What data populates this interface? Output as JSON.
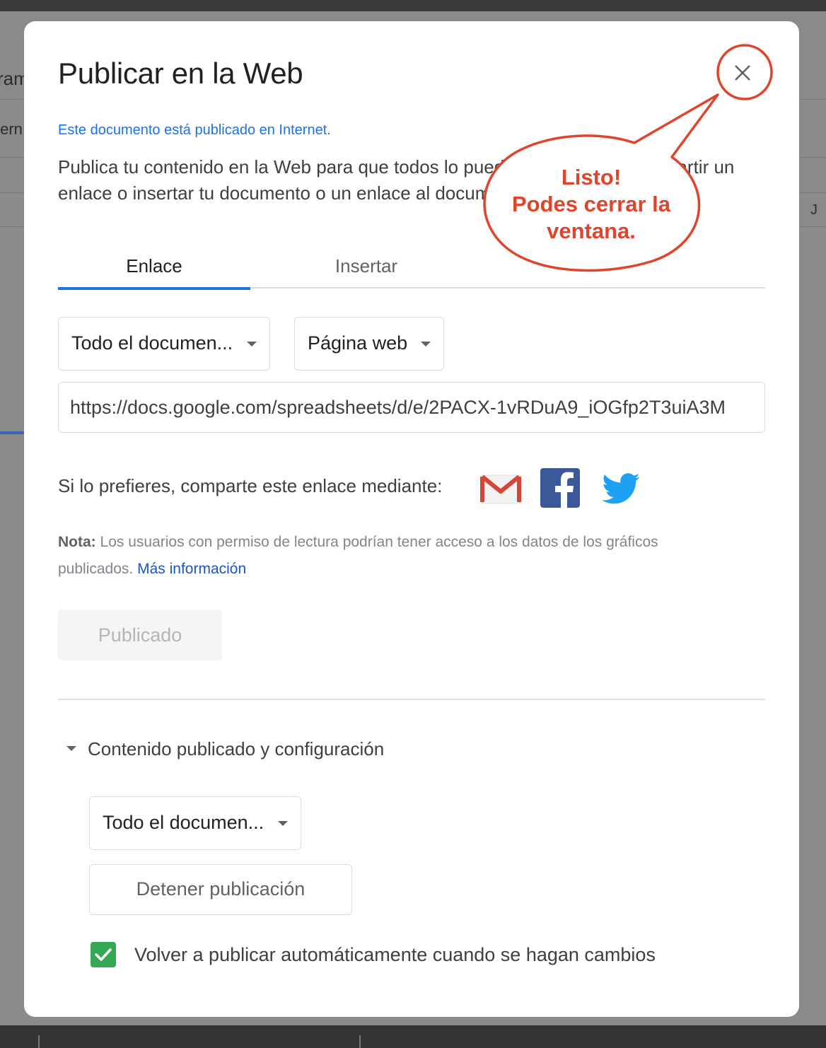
{
  "background": {
    "fragments": [
      "ram",
      "tern",
      "J"
    ]
  },
  "dialog": {
    "title": "Publicar en la Web",
    "status": "Este documento está publicado en Internet.",
    "description": "Publica tu contenido en la Web para que todos lo puedan ver. Puedes compartir un enlace o insertar tu documento o un enlace al documento.",
    "description_link": "Más información",
    "tabs": [
      {
        "label": "Enlace",
        "active": true
      },
      {
        "label": "Insertar",
        "active": false
      }
    ],
    "scope_select": "Todo el documen...",
    "format_select": "Página web",
    "url": "https://docs.google.com/spreadsheets/d/e/2PACX-1vRDuA9_iOGfp2T3uiA3M",
    "share_label": "Si lo prefieres, comparte este enlace mediante:",
    "share_icons": [
      "gmail-icon",
      "facebook-icon",
      "twitter-icon"
    ],
    "note_label": "Nota:",
    "note_text": "Los usuarios con permiso de lectura podrían tener acceso a los datos de los gráficos publicados.",
    "note_link": "Más información",
    "published_button": "Publicado",
    "section_title": "Contenido publicado y configuración",
    "section_select": "Todo el documen...",
    "stop_button": "Detener publicación",
    "auto_republish_label": "Volver a publicar automáticamente cuando se hagan cambios",
    "auto_republish_checked": true
  },
  "annotation": {
    "line1": "Listo!",
    "line2": "Podes cerrar la",
    "line3": "ventana.",
    "color": "#e0442c"
  },
  "colors": {
    "accent": "#1a73e8",
    "check": "#34a853",
    "facebook": "#3b5998",
    "twitter": "#1da1f2",
    "gmail": "#d44638"
  }
}
